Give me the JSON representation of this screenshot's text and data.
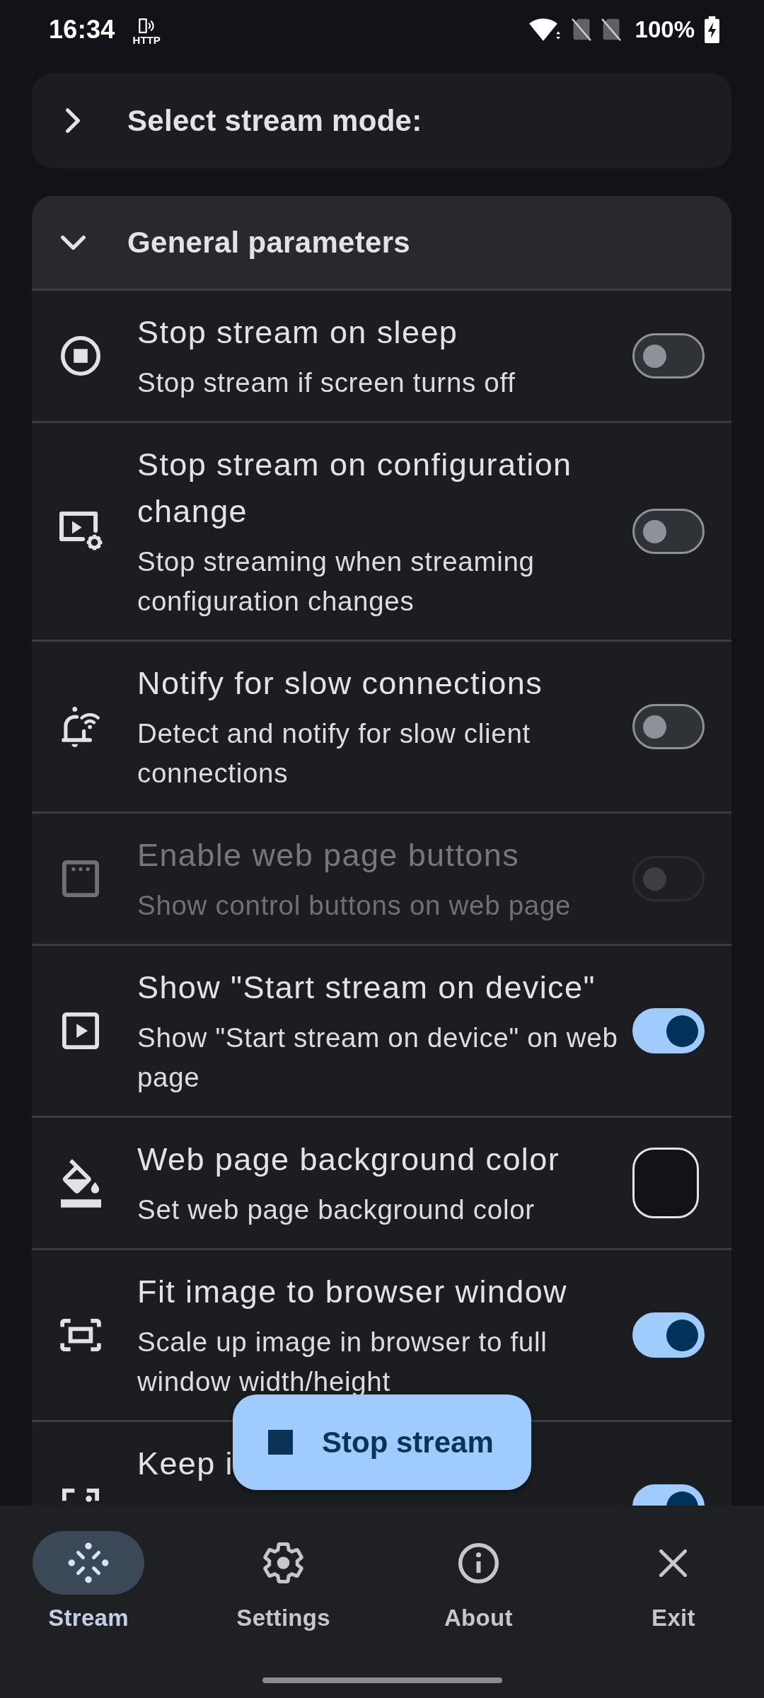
{
  "status_bar": {
    "time": "16:34",
    "notification_label": "HTTP",
    "battery": "100%"
  },
  "sections": [
    {
      "title": "Select stream mode:",
      "expanded": false
    },
    {
      "title": "General parameters",
      "expanded": true,
      "items": [
        {
          "kind": "switch",
          "title": "Stop stream on sleep",
          "subtitle": "Stop stream if screen turns off",
          "on": false,
          "disabled": false
        },
        {
          "kind": "switch",
          "title": "Stop stream on configuration change",
          "subtitle": "Stop streaming when streaming configuration changes",
          "on": false,
          "disabled": false
        },
        {
          "kind": "switch",
          "title": "Notify for slow connections",
          "subtitle": "Detect and notify for slow client connections",
          "on": false,
          "disabled": false
        },
        {
          "kind": "switch",
          "title": "Enable web page buttons",
          "subtitle": "Show control buttons on web page",
          "on": false,
          "disabled": true
        },
        {
          "kind": "switch",
          "title": "Show \"Start stream on device\"",
          "subtitle": "Show \"Start stream on device\" on web page",
          "on": true,
          "disabled": false
        },
        {
          "kind": "color",
          "title": "Web page background color",
          "subtitle": "Set web page background color",
          "color": "#111317",
          "disabled": false
        },
        {
          "kind": "switch",
          "title": "Fit image to browser window",
          "subtitle": "Scale up image in browser to full window width/height",
          "on": true,
          "disabled": false
        },
        {
          "kind": "switch",
          "title": "Keep i",
          "on": true,
          "disabled": false
        }
      ]
    }
  ],
  "fab": {
    "label": "Stop stream"
  },
  "bottom_nav": [
    {
      "label": "Stream",
      "selected": true
    },
    {
      "label": "Settings",
      "selected": false
    },
    {
      "label": "About",
      "selected": false
    },
    {
      "label": "Exit",
      "selected": false
    }
  ]
}
